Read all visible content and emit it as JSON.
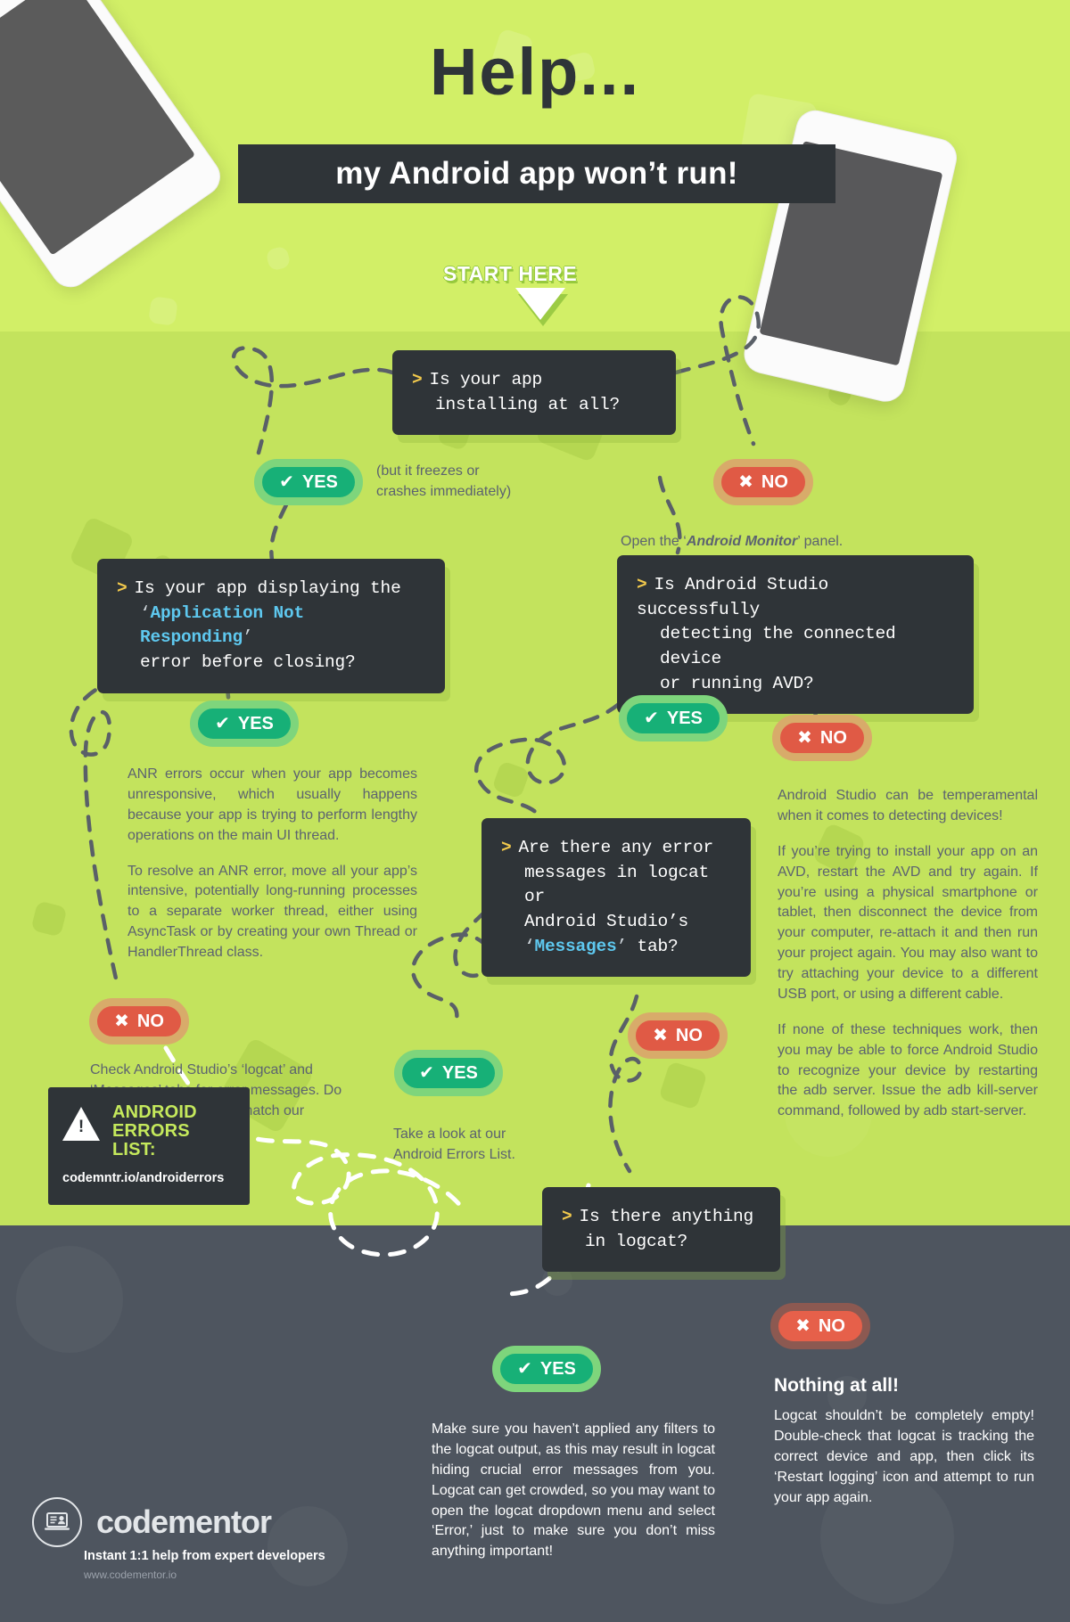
{
  "header": {
    "title": "Help...",
    "subtitle": "my Android app won’t run!",
    "start_label": "START HERE"
  },
  "colors": {
    "green_light": "#d2ef67",
    "green_mid": "#c3e35d",
    "dark_panel": "#2f3438",
    "slate": "#4e555f",
    "yes_green": "#17b077",
    "no_red": "#e05a45",
    "accent_yellow": "#f2c94c",
    "accent_cyan": "#5ec8ef",
    "lime_text": "#c5e95c"
  },
  "labels": {
    "yes": "YES",
    "no": "NO",
    "check_glyph": "✔",
    "cross_glyph": "✖",
    "prompt_glyph": ">"
  },
  "questions": {
    "q1_line1": "Is your app",
    "q1_line2": "installing at all?",
    "q2_line1": "Is your app displaying the",
    "q2_line2_hl": "Application Not Responding",
    "q2_line3": "error before closing?",
    "q3_line1": "Is Android Studio successfully",
    "q3_line2": "detecting the connected device",
    "q3_line3": "or running AVD?",
    "q4_line1": "Are there any error",
    "q4_line2": "messages in logcat or",
    "q4_line3": "Android Studio’s",
    "q4_line4_hl": "Messages",
    "q4_line4_tail": " tab?",
    "q5_line1": "Is there anything",
    "q5_line2": "in logcat?"
  },
  "notes": {
    "q1_yes_caption_l1": "(but it freezes or",
    "q1_yes_caption_l2": "crashes immediately)",
    "q1_no_caption_pre": "Open the ‘",
    "q1_no_caption_em": "Android Monitor",
    "q1_no_caption_post": "’ panel.",
    "anr_p1": "ANR errors occur when your app becomes unresponsive, which usually happens because your app is trying to perform lengthy operations on the main UI thread.",
    "anr_p2": "To resolve an ANR error, move all your app’s intensive, potentially long-running processes to a separate worker thread, either using AsyncTask or by creating your own Thread or HandlerThread class.",
    "anr_no_text": "Check Android Studio’s ‘logcat’ and ‘Messages’ tabs for error messages. Do any of these messages match our Android Errors List?",
    "errors_yes_text": "Take a look at our Android Errors List.",
    "device_p1": "Android Studio can be temperamental when it comes to detecting devices!",
    "device_p2": "If you’re trying to install your app on an AVD, restart the AVD and try again. If you’re using a physical smartphone or tablet, then disconnect the device from your computer, re-attach it and then run your project again. You may also want to try attaching your device to a different USB port, or using a different cable.",
    "device_p3": "If none of these techniques work, then you may be able to force Android Studio to recognize your device by restarting the adb server. Issue the adb kill-server command, followed by adb start-server.",
    "logcat_yes_text": "Make sure you haven’t applied any filters to the logcat output, as this may result in logcat hiding crucial error messages from you. Logcat can get crowded, so you may want to open the logcat dropdown menu and select ‘Error,’ just to make sure you don’t miss anything important!",
    "nothing_heading": "Nothing at all!",
    "nothing_text": "Logcat shouldn’t be completely empty! Double-check that logcat is tracking the correct device and app, then click its ‘Restart logging’ icon and attempt to run your app again."
  },
  "errors_card": {
    "title_l1": "ANDROID",
    "title_l2": "ERRORS",
    "title_l3": "LIST:",
    "url": "codemntr.io/androiderrors"
  },
  "footer": {
    "brand": "codementor",
    "tagline": "Instant 1:1 help from expert developers",
    "url": "www.codementor.io"
  }
}
